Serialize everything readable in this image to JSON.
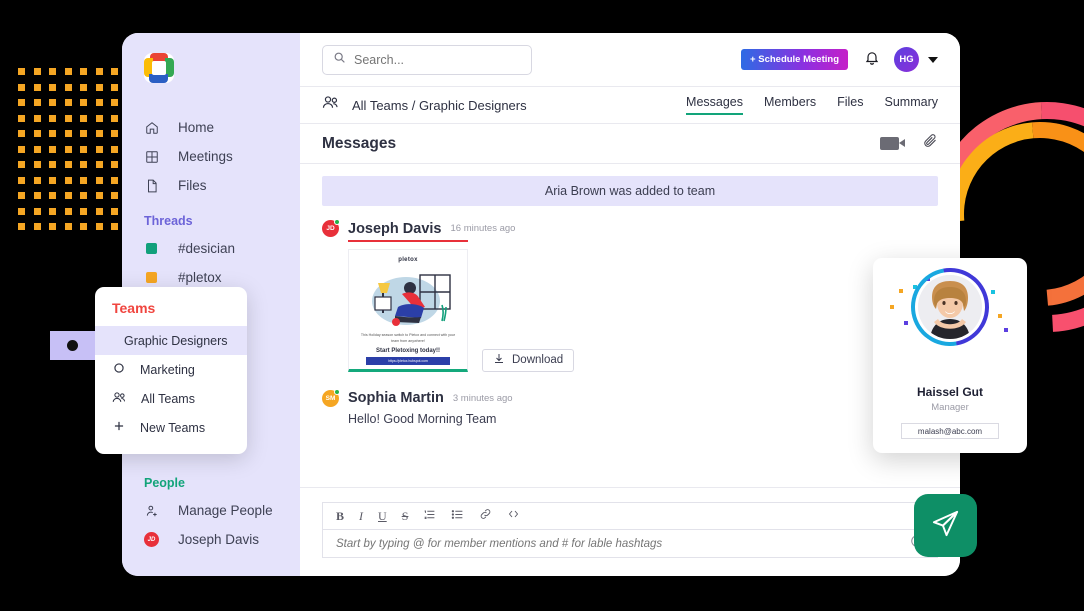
{
  "sidebar": {
    "logo_name": "app-logo",
    "nav": [
      {
        "label": "Home",
        "icon": "home-icon"
      },
      {
        "label": "Meetings",
        "icon": "grid-icon"
      },
      {
        "label": "Files",
        "icon": "file-icon"
      }
    ],
    "threads_header": "Threads",
    "threads": [
      {
        "label": "#desician",
        "color": "#11A07B"
      },
      {
        "label": "#pletox",
        "color": "#F5A623"
      }
    ],
    "people_header": "People",
    "people": [
      {
        "label": "Manage People",
        "icon": "add-person-icon"
      },
      {
        "label": "Joseph Davis",
        "icon": "avatar",
        "initials": "JD"
      }
    ]
  },
  "topbar": {
    "search_placeholder": "Search...",
    "search_value": "",
    "schedule_label": "+ Schedule Meeting",
    "avatar_initials": "HG"
  },
  "crumbbar": {
    "breadcrumb": "All Teams / Graphic Designers",
    "tabs": [
      {
        "label": "Messages",
        "active": true
      },
      {
        "label": "Members",
        "active": false
      },
      {
        "label": "Files",
        "active": false
      },
      {
        "label": "Summary",
        "active": false
      }
    ]
  },
  "messages_panel": {
    "title": "Messages",
    "system_message": "Aria Brown was added to team",
    "messages": [
      {
        "author": "Joseph Davis",
        "initials": "JD",
        "time": "16 minutes ago",
        "text": "",
        "attachment": {
          "logo": "pletox",
          "caption": "This Holiday season switch to Pletox and connect with your team from anywhere!",
          "subtitle": "Start Pletoxing today!!",
          "url": "https://pletox.hubspot.com",
          "download_label": "Download"
        }
      },
      {
        "author": "Sophia Martin",
        "initials": "SM",
        "time": "3 minutes ago",
        "text": "Hello! Good Morning Team",
        "attachment": null
      }
    ]
  },
  "composer": {
    "tools": [
      {
        "label": "B",
        "name": "bold-icon"
      },
      {
        "label": "I",
        "name": "italic-icon"
      },
      {
        "label": "U",
        "name": "underline-icon"
      },
      {
        "label": "S",
        "name": "strikethrough-icon"
      },
      {
        "label": "≡",
        "name": "ordered-list-icon"
      },
      {
        "label": "≣",
        "name": "bullet-list-icon"
      },
      {
        "label": "⚭",
        "name": "link-icon"
      },
      {
        "label": "‹›",
        "name": "code-icon"
      }
    ],
    "placeholder": "Start by typing @ for member mentions and # for lable hashtags",
    "value": ""
  },
  "teams_popup": {
    "title": "Teams",
    "items": [
      {
        "label": "Graphic Designers",
        "selected": true,
        "icon": ""
      },
      {
        "label": "Marketing",
        "selected": false,
        "icon": "circle-icon"
      },
      {
        "label": "All Teams",
        "selected": false,
        "icon": "people-icon"
      },
      {
        "label": "New  Teams",
        "selected": false,
        "icon": "plus-icon"
      }
    ]
  },
  "profile_card": {
    "name": "Haissel Gut",
    "role": "Manager",
    "email": "malash@abc.com"
  },
  "colors": {
    "sidebar_bg": "#E5E3FB",
    "accent_green": "#12A47A",
    "accent_purple": "#6C63D8",
    "accent_red": "#F0453F",
    "send_green": "#0E8F66",
    "dot_orange": "#F5A623"
  }
}
